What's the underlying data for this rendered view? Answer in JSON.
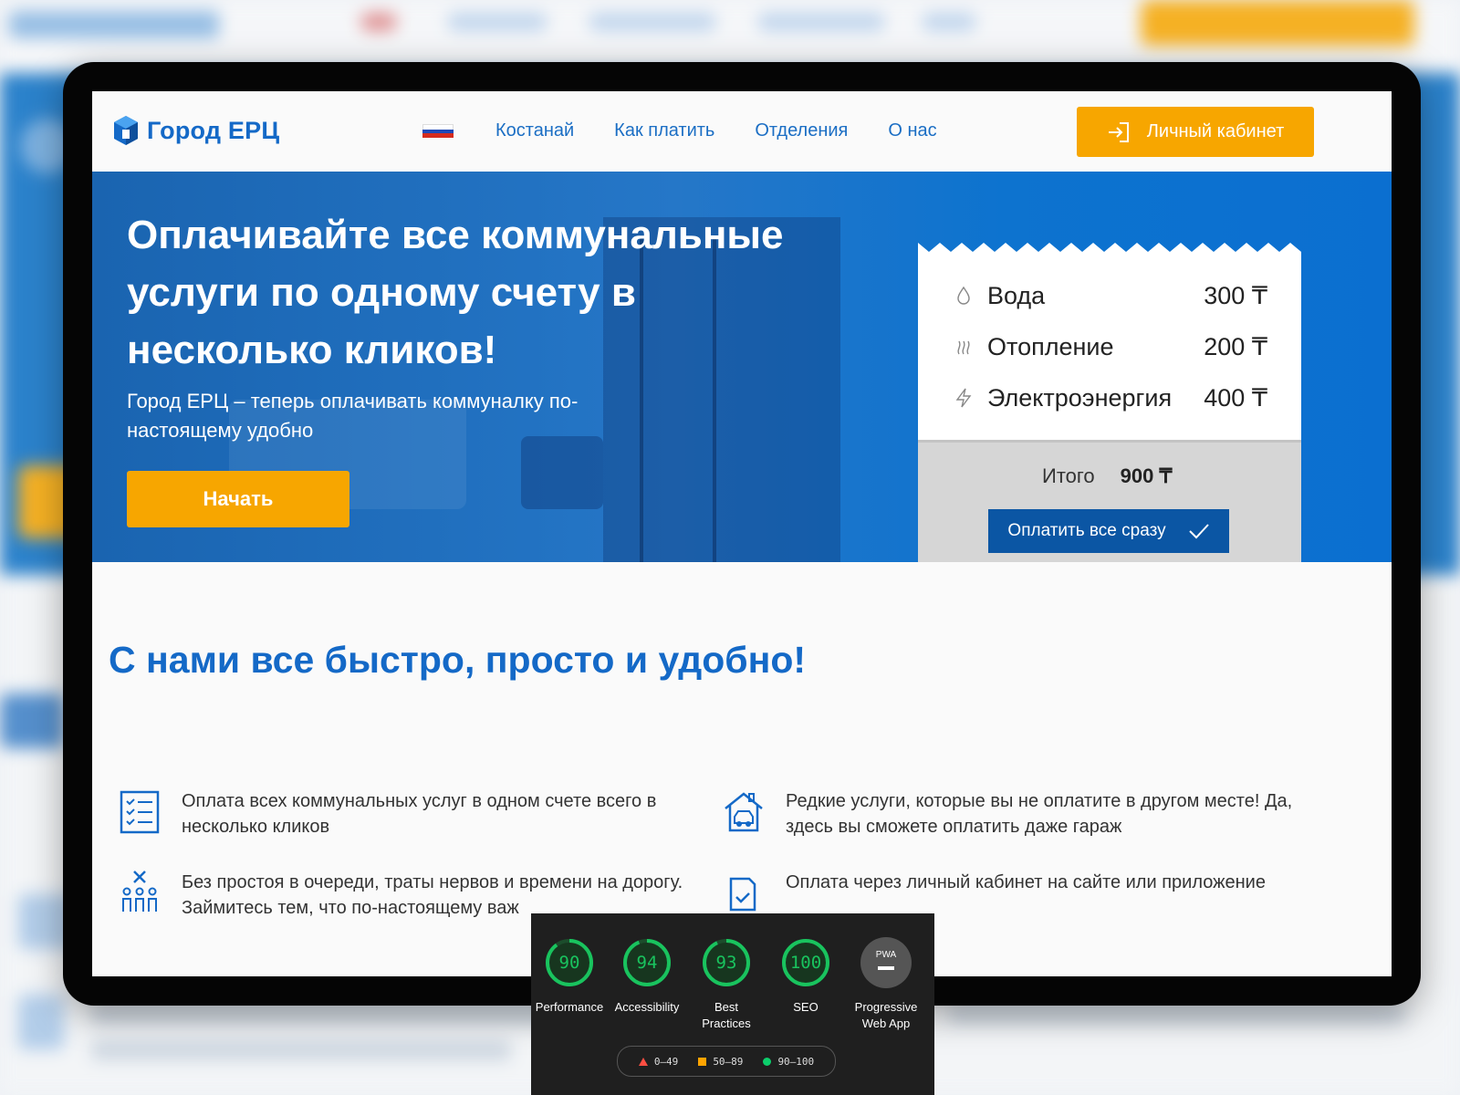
{
  "header": {
    "logo": "Город ЕРЦ",
    "nav": [
      "Костанай",
      "Как платить",
      "Отделения",
      "О нас"
    ],
    "cabinet": "Личный кабинет"
  },
  "hero": {
    "title": "Оплачивайте все коммунальные услуги по одному счету в несколько кликов!",
    "subtitle": "Город ЕРЦ – теперь оплачивать коммуналку по-настоящему удобно",
    "start": "Начать"
  },
  "receipt": {
    "items": [
      {
        "name": "Вода",
        "value": "300 ₸",
        "icon": "drop-icon"
      },
      {
        "name": "Отопление",
        "value": "200 ₸",
        "icon": "heat-icon"
      },
      {
        "name": "Электроэнергия",
        "value": "400 ₸",
        "icon": "lightning-icon"
      }
    ],
    "total_label": "Итого",
    "total_value": "900 ₸",
    "pay_all": "Оплатить все сразу"
  },
  "section": {
    "title": "С нами все быстро, просто и удобно!",
    "features": [
      "Оплата всех коммунальных услуг в одном счете всего в несколько кликов",
      "Редкие услуги, которые вы не оплатите в другом месте! Да, здесь вы сможете оплатить даже гараж",
      "Без простоя в очереди, траты нервов и времени на дорогу. Займитесь тем, что по-настоящему важ",
      "Оплата через личный кабинет на сайте или приложение"
    ]
  },
  "lighthouse": {
    "scores": [
      {
        "value": "90",
        "label": "Performance",
        "fraction": 0.9
      },
      {
        "value": "94",
        "label": "Accessibility",
        "fraction": 0.94
      },
      {
        "value": "93",
        "label": "Best Practices",
        "fraction": 0.93
      },
      {
        "value": "100",
        "label": "SEO",
        "fraction": 1.0
      }
    ],
    "pwa": {
      "badge": "PWA",
      "label": "Progressive Web App"
    },
    "legend": [
      "0–49",
      "50–89",
      "90–100"
    ]
  },
  "colors": {
    "brand": "#1469c7",
    "accent": "#f7a600",
    "good": "#19c35e",
    "dark_button": "#0b56a4"
  }
}
